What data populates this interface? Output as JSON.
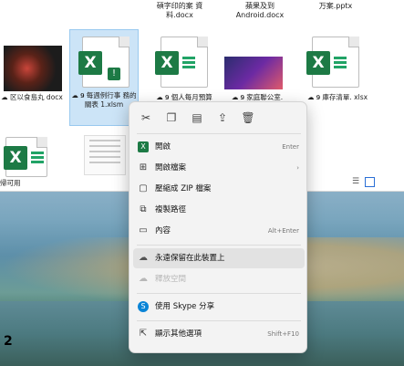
{
  "top_row_names": [
    {
      "id": "a",
      "text": "碩字印的案 資料.docx"
    },
    {
      "id": "b",
      "text": "蘋果及到 Android.docx"
    },
    {
      "id": "c",
      "text": "万案.pptx"
    }
  ],
  "files": [
    {
      "id": "f1",
      "label": "区以食島丸 docx",
      "cloud": "☁"
    },
    {
      "id": "f2",
      "label": "每週例行事 務的關表 1.xlsm",
      "cloud": "☁ 𝟗"
    },
    {
      "id": "f3",
      "label": "個人每月預算",
      "cloud": "☁ 𝟗"
    },
    {
      "id": "f4",
      "label": "家庭聯公室.",
      "cloud": "☁ 𝟗"
    },
    {
      "id": "f5",
      "label": "庫存清單. xlsx",
      "cloud": "☁ 𝟗"
    },
    {
      "id": "f6",
      "label": "帰可用",
      "cloud": ""
    }
  ],
  "context_menu": {
    "toolbar_icons": [
      "cut-icon",
      "copy-icon",
      "rename-icon",
      "share-icon",
      "delete-icon"
    ],
    "items": [
      {
        "label": "開啟",
        "shortcut": "Enter",
        "icon": "excel-icon"
      },
      {
        "label": "開啟檔案",
        "shortcut": "›",
        "icon": "open-with-icon"
      },
      {
        "label": "壓縮成 ZIP 檔案",
        "shortcut": "",
        "icon": "zip-icon"
      },
      {
        "label": "複製路徑",
        "shortcut": "",
        "icon": "copy-path-icon"
      },
      {
        "label": "內容",
        "shortcut": "Alt+Enter",
        "icon": "properties-icon"
      },
      {
        "label": "永遠保留在此裝置上",
        "shortcut": "",
        "icon": "cloud-keep-icon"
      },
      {
        "label": "釋放空間",
        "shortcut": "",
        "icon": "cloud-free-icon"
      },
      {
        "label": "使用 Skype 分享",
        "shortcut": "",
        "icon": "skype-icon"
      },
      {
        "label": "顯示其他選項",
        "shortcut": "Shift+F10",
        "icon": "more-options-icon"
      }
    ]
  },
  "step_label": "2",
  "colors": {
    "excel_green": "#1d7a45",
    "selection": "#cce4f7",
    "menu_bg": "#f3f3f3"
  }
}
